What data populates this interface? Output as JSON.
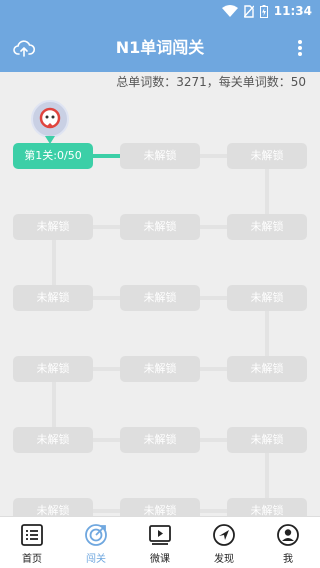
{
  "status_bar": {
    "time": "11:34"
  },
  "app_bar": {
    "title": "N1单词闯关",
    "cloud_icon": "cloud-upload-icon",
    "menu_icon": "more-vert-icon"
  },
  "summary": "总单词数：3271，每关单词数：50",
  "levels": {
    "current_label": "第1关:0/50",
    "locked_label": "未解锁"
  },
  "colors": {
    "accent": "#6fa7df",
    "unlocked": "#3ccfa7",
    "locked": "#dedede"
  },
  "tabs": [
    {
      "label": "首页",
      "icon": "list-icon"
    },
    {
      "label": "闯关",
      "icon": "target-icon"
    },
    {
      "label": "微课",
      "icon": "video-play-icon"
    },
    {
      "label": "发现",
      "icon": "compass-icon"
    },
    {
      "label": "我",
      "icon": "user-icon"
    }
  ],
  "active_tab": "闯关"
}
